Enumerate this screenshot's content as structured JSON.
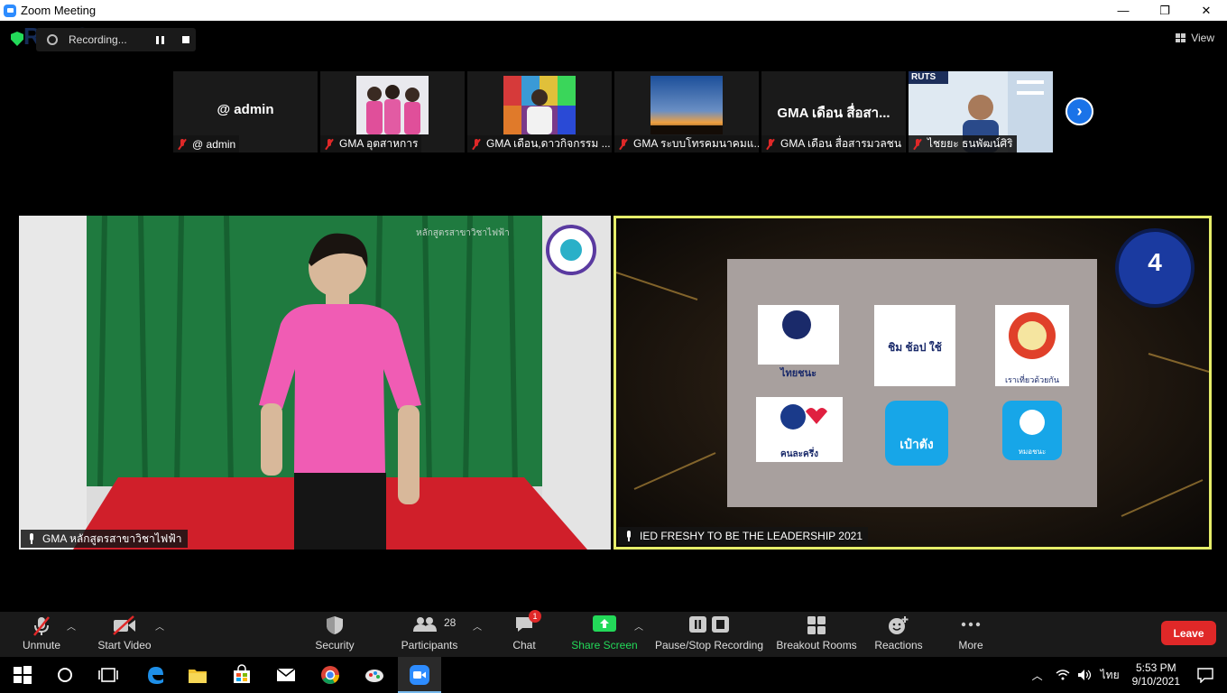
{
  "window": {
    "title": "Zoom Meeting",
    "min": "—",
    "max": "❐",
    "close": "✕"
  },
  "recording": {
    "label": "Recording..."
  },
  "watermark": "RUTS",
  "view": {
    "label": "View"
  },
  "thumbnails": [
    {
      "big_name": "@ admin",
      "name": "@ admin",
      "muted": true,
      "video": false
    },
    {
      "big_name": "",
      "name": "GMA อุตสาหการ",
      "muted": true,
      "video": true
    },
    {
      "big_name": "",
      "name": "GMA เดือน,ดาวกิจกรรม ...",
      "muted": true,
      "video": true
    },
    {
      "big_name": "",
      "name": "GMA ระบบโทรคมนาคมแ...",
      "muted": true,
      "video": true
    },
    {
      "big_name": "GMA เดือน สื่อสา...",
      "name": "GMA เดือน สื่อสารมวลชน",
      "muted": true,
      "video": false
    },
    {
      "big_name": "",
      "name": "ไชยยะ ธนพัฒน์ศิริ",
      "muted": true,
      "video": true,
      "logo": "RUTS"
    }
  ],
  "main_tiles": [
    {
      "name": "GMA หลักสูตรสาขาวิชาไฟฟ้า",
      "screen_text": "หลักสูตรสาขาวิชาไฟฟ้า"
    },
    {
      "name": "IED FRESHY TO BE THE LEADERSHIP 2021",
      "number": "4",
      "apps": [
        "ไทยชนะ",
        "ชิม ช้อป ใช้",
        "เราเที่ยวด้วยกัน",
        "คนละครึ่ง",
        "เป๋าตัง",
        "หมอชนะ"
      ]
    }
  ],
  "toolbar": {
    "unmute": "Unmute",
    "start_video": "Start Video",
    "security": "Security",
    "participants": "Participants",
    "participants_count": "28",
    "chat": "Chat",
    "chat_badge": "1",
    "share_screen": "Share Screen",
    "pause_stop": "Pause/Stop Recording",
    "breakout": "Breakout Rooms",
    "reactions": "Reactions",
    "more": "More",
    "leave": "Leave"
  },
  "taskbar": {
    "lang": "ไทย",
    "time": "5:53 PM",
    "date": "9/10/2021"
  },
  "colors": {
    "accent": "#2d8cff",
    "leave": "#e02828",
    "share": "#23d959",
    "speaker_border": "#e6ee6a"
  }
}
